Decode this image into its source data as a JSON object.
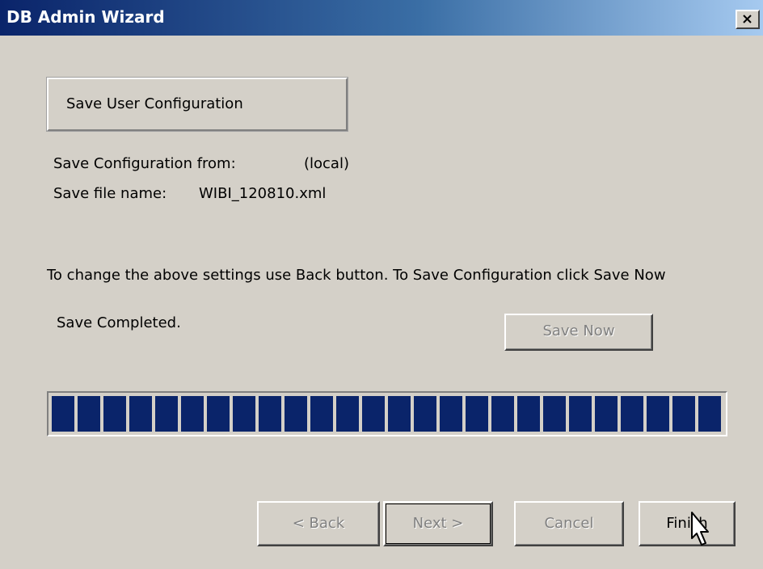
{
  "window": {
    "title": "DB Admin Wizard",
    "close_label": "×"
  },
  "header": {
    "title": "Save User Configuration"
  },
  "config": {
    "from_label": "Save Configuration from:",
    "from_value": "(local)",
    "file_label": "Save file name:",
    "file_value": "WIBI_120810.xml"
  },
  "instructions": "To change the above settings use Back button. To Save Configuration click Save Now",
  "status": "Save Completed.",
  "save_now_label": "Save Now",
  "progress": {
    "percent": 100
  },
  "buttons": {
    "back": "< Back",
    "next": "Next >",
    "cancel": "Cancel",
    "finish": "Finish"
  },
  "colors": {
    "progress_fill": "#0a246a",
    "window_bg": "#d4d0c8"
  }
}
